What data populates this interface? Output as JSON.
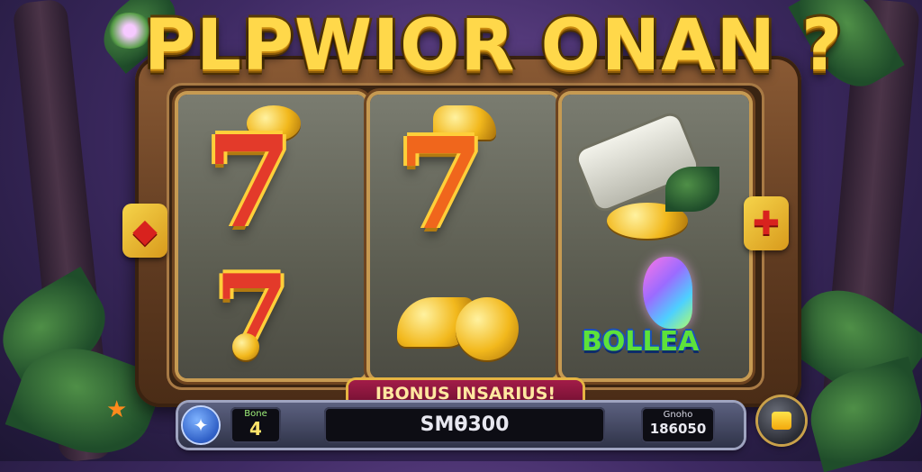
{
  "title": "PLPWIOR ONAN ?",
  "banner": "IBONUS INSARIUS!",
  "status_bar": {
    "left_label": "Bone",
    "left_value": "4",
    "center_value": "SMθ300",
    "right_label": "Gnoho",
    "right_value": "186050"
  },
  "reels": [
    {
      "top_symbol": "7",
      "bottom_symbol": "7"
    },
    {
      "top_symbol": "7"
    },
    {
      "bottom_label": "BOLLEA"
    }
  ],
  "colors": {
    "title_gold": "#ffd84a",
    "seven_red": "#e33a2a",
    "banner_magenta": "#a21c48",
    "bonus_green": "#5de23a"
  }
}
